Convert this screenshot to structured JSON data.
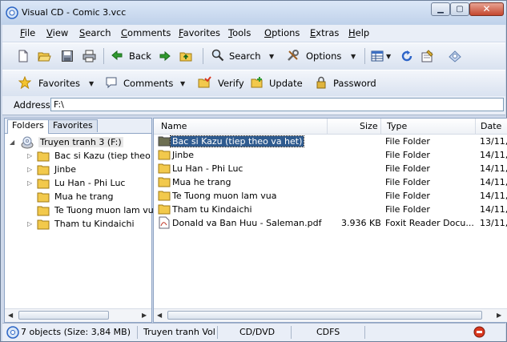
{
  "window": {
    "title": "Visual CD - Comic 3.vcc"
  },
  "menu": [
    "File",
    "View",
    "Search",
    "Comments",
    "Favorites",
    "Tools",
    "Options",
    "Extras",
    "Help"
  ],
  "toolbar1": {
    "back": "Back",
    "search": "Search",
    "options": "Options"
  },
  "toolbar2": {
    "favorites": "Favorites",
    "comments": "Comments",
    "verify": "Verify",
    "update": "Update",
    "password": "Password"
  },
  "address": {
    "label": "Address",
    "value": "F:\\"
  },
  "left_tabs": {
    "folders": "Folders",
    "favorites": "Favorites"
  },
  "tree": {
    "root": "Truyen tranh 3 (F:)",
    "children": [
      "Bac si Kazu (tiep theo va",
      "Jinbe",
      "Lu Han - Phi Luc",
      "Mua he trang",
      "Te Tuong muon lam vua",
      "Tham tu Kindaichi"
    ]
  },
  "columns": {
    "name": "Name",
    "size": "Size",
    "type": "Type",
    "date": "Date"
  },
  "files": [
    {
      "name": "Bac si Kazu (tiep theo va het)",
      "size": "",
      "type": "File Folder",
      "date": "13/11,"
    },
    {
      "name": "Jinbe",
      "size": "",
      "type": "File Folder",
      "date": "14/11,"
    },
    {
      "name": "Lu Han - Phi Luc",
      "size": "",
      "type": "File Folder",
      "date": "14/11,"
    },
    {
      "name": "Mua he trang",
      "size": "",
      "type": "File Folder",
      "date": "14/11,"
    },
    {
      "name": "Te Tuong muon lam vua",
      "size": "",
      "type": "File Folder",
      "date": "14/11,"
    },
    {
      "name": "Tham tu Kindaichi",
      "size": "",
      "type": "File Folder",
      "date": "14/11,"
    },
    {
      "name": "Donald va Ban Huu - Saleman.pdf",
      "size": "3.936 KB",
      "type": "Foxit Reader Docu...",
      "date": "13/11,"
    }
  ],
  "status": {
    "objects": "7 objects (Size: 3,84 MB)",
    "volume": "Truyen tranh Vol",
    "media": "CD/DVD",
    "fs": "CDFS"
  },
  "colors": {
    "selection": "#2f5b8f",
    "folder": "#f2c94c"
  }
}
